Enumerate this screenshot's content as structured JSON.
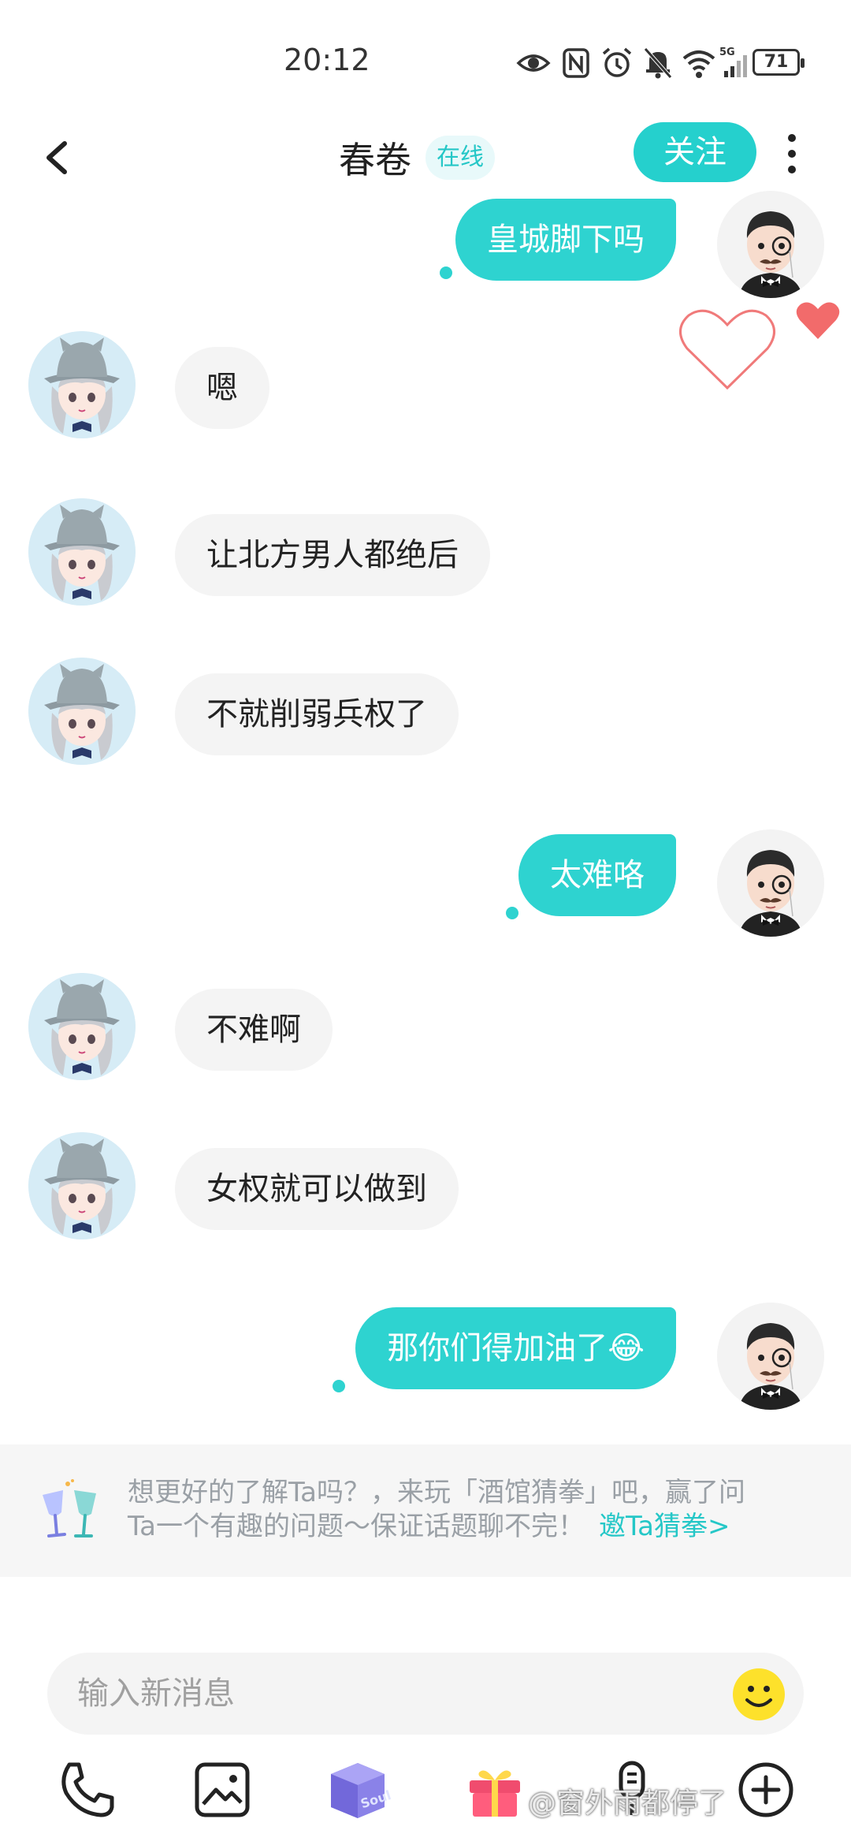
{
  "status_bar": {
    "time": "20:12",
    "battery": "71"
  },
  "header": {
    "title": "春卷",
    "online": "在线",
    "follow": "关注"
  },
  "messages": [
    {
      "side": "out",
      "text": "皇城脚下吗"
    },
    {
      "side": "in",
      "text": "嗯"
    },
    {
      "side": "in",
      "text": "让北方男人都绝后"
    },
    {
      "side": "in",
      "text": "不就削弱兵权了"
    },
    {
      "side": "out",
      "text": "太难咯"
    },
    {
      "side": "in",
      "text": "不难啊"
    },
    {
      "side": "in",
      "text": "女权就可以做到"
    },
    {
      "side": "out",
      "text": "那你们得加油了😂"
    }
  ],
  "banner": {
    "line1": "想更好的了解Ta吗？，来玩「酒馆猜拳」吧，赢了问",
    "line2": "Ta一个有趣的问题～保证话题聊不完！",
    "link": "邀Ta猜拳>"
  },
  "input": {
    "placeholder": "输入新消息"
  },
  "toolbar": {
    "soul_label": "Soul"
  },
  "watermark": "@窗外雨都停了",
  "colors": {
    "accent": "#2ed3d0",
    "heart": "#f26b6b"
  }
}
